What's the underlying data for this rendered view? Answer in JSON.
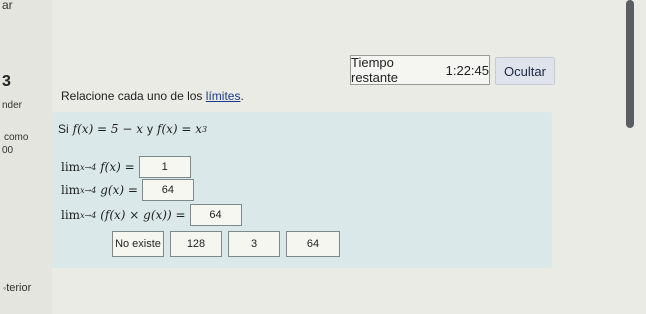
{
  "sidebar": {
    "top_fragment": "ar",
    "question_number": "3",
    "fragments": [
      "nder",
      "como",
      "00"
    ],
    "previous_label": "terior"
  },
  "timer": {
    "label": "Tiempo restante",
    "value": "1:22:45"
  },
  "hide_button": "Ocultar",
  "instruction": {
    "text": "Relacione cada uno de los ",
    "link": "límites",
    "end": "."
  },
  "given": {
    "prefix": "Si",
    "f_def": "f(x) = 5 − x",
    "conj": "y",
    "g_def_base": "f(x) = x",
    "g_def_exp": "3"
  },
  "limits": [
    {
      "lim": "lim",
      "sub": "x→4",
      "expr": "f(x) =",
      "answer": "1"
    },
    {
      "lim": "lim",
      "sub": "x→4",
      "expr": "g(x) =",
      "answer": "64"
    },
    {
      "lim": "lim",
      "sub": "x→4",
      "expr": "(f(x) × g(x)) =",
      "answer": "64"
    }
  ],
  "choices": [
    "No existe",
    "128",
    "3",
    "64"
  ]
}
